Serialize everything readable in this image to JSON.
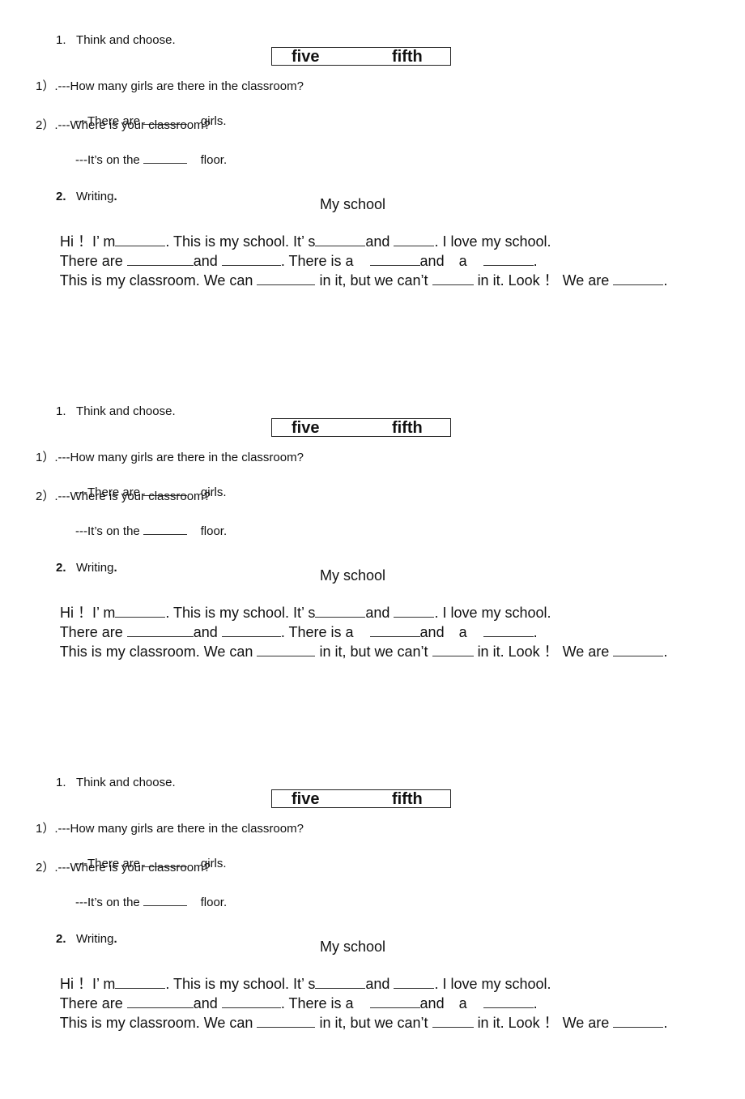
{
  "sections": [
    {
      "q1": {
        "number": "1.",
        "title": "Think and choose.",
        "words": [
          "five",
          "fifth"
        ],
        "items": [
          {
            "label": "1）.---How many girls are there in the classroom?",
            "answer_prefix": "---There are",
            "answer_suffix": "girls."
          },
          {
            "label": "2）.---Where is your classroom?",
            "answer_prefix": "---It’s on the",
            "answer_suffix": "floor."
          }
        ]
      },
      "q2": {
        "number": "2.",
        "title": "Writing",
        "title_period": ".",
        "essay_title": "My school",
        "line1": [
          "Hi ！I’ m",
          ". This is my school. It’ s",
          "and",
          ". I love my school."
        ],
        "line2": [
          "There are",
          "and",
          ". There is a",
          "and　a",
          "."
        ],
        "line3": [
          "This is my classroom. We can",
          "in it, but we can’t",
          "in it. Look ！ We are",
          "."
        ]
      }
    }
  ]
}
